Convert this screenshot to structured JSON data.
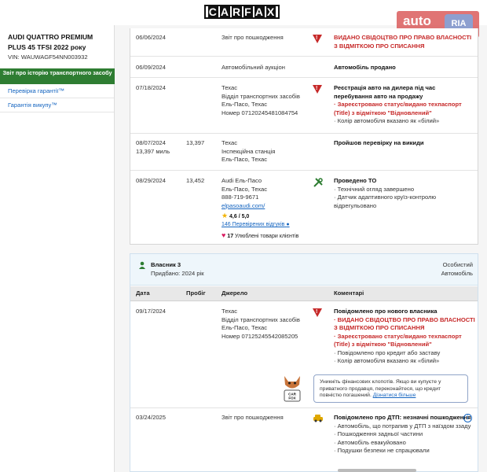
{
  "header": {
    "logo_letters": [
      "C",
      "A",
      "R",
      "F",
      "A",
      "X"
    ],
    "watermark": "auto",
    "watermark_badge": "RIA"
  },
  "sidebar": {
    "car_title": "AUDI QUATTRO PREMIUM PLUS 45 TFSI 2022 року",
    "vin": "VIN: WAUWAGF54NN003932",
    "history_button": "Звіт про історію транспортного засобу",
    "links": [
      "Перевірка гарантії™",
      "Гарантія викупу™"
    ]
  },
  "records": [
    {
      "date": "06/06/2024",
      "odo": "",
      "source": [
        "Звіт про пошкодження"
      ],
      "icon": "warning-icon",
      "comments": [
        {
          "text": "ВИДАНО СВІДОЦТВО ПРО ПРАВО ВЛАСНОСТІ З ВІДМІТКОЮ ПРО СПИСАННЯ",
          "style": "red"
        }
      ]
    },
    {
      "date": "06/09/2024",
      "odo": "",
      "source": [
        "Автомобільний аукціон"
      ],
      "icon": "",
      "comments": [
        {
          "text": "Автомобіль продано",
          "style": "bold"
        }
      ]
    },
    {
      "date": "07/18/2024",
      "odo": "",
      "source": [
        "Техас",
        "Відділ транспортних засобів",
        "Ель-Пасо, Техас",
        "Номер 07120245481084754"
      ],
      "icon": "warning-icon",
      "comments": [
        {
          "text": "Реєстрація авто на дилера під час перебування авто на продажу",
          "style": "bold"
        },
        {
          "text": "Зареєстровано статус/видано техпаспорт (Title) з відміткою \"Відновлений\"",
          "style": "red-bullet"
        },
        {
          "text": "Колір автомобіля вказано як «білий»",
          "style": "bullet"
        }
      ]
    },
    {
      "date": "08/07/2024",
      "date2": "13,397 миль",
      "odo": "13,397",
      "source": [
        "Техас",
        "Інспекційна станція",
        "Ель-Пасо, Техас"
      ],
      "icon": "",
      "comments": [
        {
          "text": "Пройшов перевірку на викиди",
          "style": "bold"
        }
      ]
    },
    {
      "date": "08/29/2024",
      "odo": "13,452",
      "source": [
        "Audi Ель-Пасо",
        "Ель-Пасо, Техас",
        "888-719-9671",
        "elpasoaudi.com/"
      ],
      "icon": "tools-icon",
      "rating": "4,6 / 5,0",
      "reviews": "146 Перевірених відгуків",
      "favorites": "17",
      "favorites_text": "Улюблені товари клієнтів",
      "comments": [
        {
          "text": "Проведено ТО",
          "style": "bold"
        },
        {
          "text": "Технічний огляд завершено",
          "style": "bullet"
        },
        {
          "text": "Датчик адаптивного круїз-контролю відрегульовано",
          "style": "bullet"
        }
      ]
    }
  ],
  "owner": {
    "title": "Власник 3",
    "purchased": "Придбано: 2024 рік",
    "type_line1": "Особистий",
    "type_line2": "Автомобіль",
    "columns": [
      "Дата",
      "Пробіг",
      "Джерело",
      "Коментарі"
    ],
    "rows": [
      {
        "date": "09/17/2024",
        "odo": "",
        "source": [
          "Техас",
          "Відділ транспортних засобів",
          "Ель-Пасо, Техас",
          "Номер 07125245542085205"
        ],
        "icon": "warning-icon",
        "comments": [
          {
            "text": "Повідомлено про нового власника",
            "style": "bold"
          },
          {
            "text": "ВИДАНО СВІДОЦТВО ПРО ПРАВО ВЛАСНОСТІ З ВІДМІТКОЮ ПРО СПИСАННЯ",
            "style": "red-bullet"
          },
          {
            "text": "Зареєстровано статус/видано техпаспорт (Title) з відміткою \"Відновлений\"",
            "style": "red-bullet"
          },
          {
            "text": "Повідомлено про кредит або заставу",
            "style": "bullet"
          },
          {
            "text": "Колір автомобіля вказано як «білий»",
            "style": "bullet"
          }
        ]
      },
      {
        "date": "03/24/2025",
        "odo": "",
        "source": [
          "Звіт про пошкодження"
        ],
        "icon": "car-crash-icon",
        "comments": [
          {
            "text": "Повідомлено про ДТП: незначні пошкодження",
            "style": "bold"
          },
          {
            "text": "Автомобіль, що потрапив у ДТП з наїздом ззаду",
            "style": "bullet"
          },
          {
            "text": "Пошкодження задньої частини",
            "style": "bullet"
          },
          {
            "text": "Автомобіль евакуйовано",
            "style": "bullet"
          },
          {
            "text": "Подушки безпеки не спрацювали",
            "style": "bullet"
          }
        ]
      }
    ],
    "tip_text": "Уникніть фінансових клопотів. Якщо ви купуєте у приватного продавця, переконайтеся, що кредит повністю погашений.",
    "tip_link": "Дізнатися більше",
    "fox_sign": "CAR FOX"
  },
  "colors": {
    "accent_green": "#2e7d32",
    "warning_red": "#c62828",
    "link_blue": "#1565c0"
  }
}
